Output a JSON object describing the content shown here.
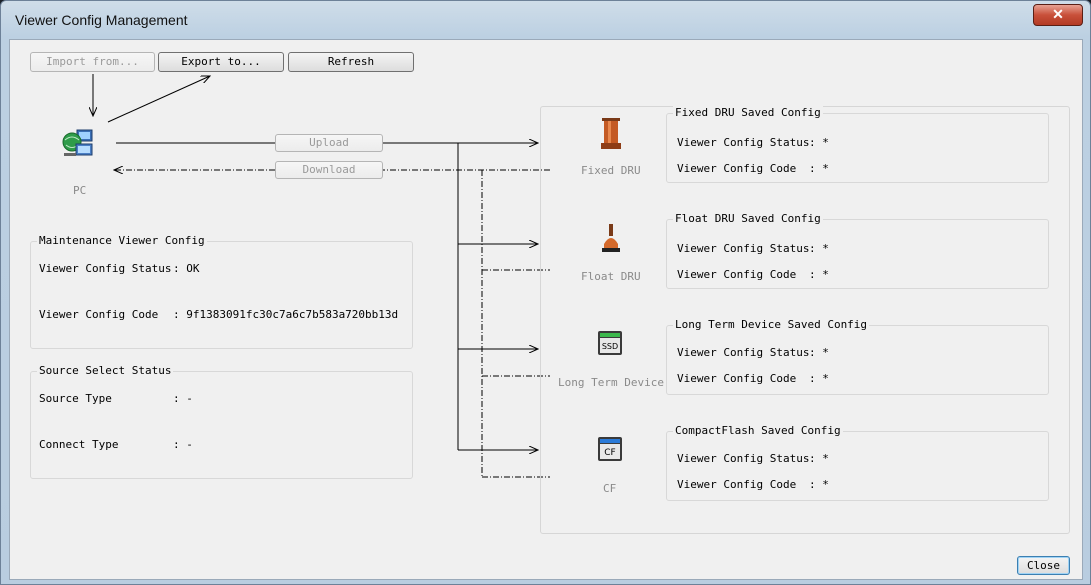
{
  "window": {
    "title": "Viewer Config Management",
    "close_glyph": "✕"
  },
  "toolbar": {
    "import_label": "Import from...",
    "export_label": "Export to...",
    "refresh_label": "Refresh"
  },
  "pc": {
    "label": "PC",
    "icon": "pc-network-icon"
  },
  "transfer": {
    "upload_label": "Upload",
    "download_label": "Download"
  },
  "maintenance": {
    "title": "Maintenance Viewer Config",
    "status_label": "Viewer Config Status",
    "status_value": ": OK",
    "code_label": "Viewer Config Code",
    "code_value": ": 9f1383091fc30c7a6c7b583a720bb13d"
  },
  "source": {
    "title": "Source Select Status",
    "type_label": "Source Type",
    "type_value": ": -",
    "connect_label": "Connect Type",
    "connect_value": ": -"
  },
  "devices": [
    {
      "label": "Fixed DRU",
      "icon": "fixed-dru-icon",
      "config_title": "Fixed DRU Saved Config",
      "status_label": "Viewer Config Status",
      "status_value": ": *",
      "code_label": "Viewer Config Code",
      "code_value": ": *"
    },
    {
      "label": "Float DRU",
      "icon": "float-dru-icon",
      "config_title": "Float DRU Saved Config",
      "status_label": "Viewer Config Status",
      "status_value": ": *",
      "code_label": "Viewer Config Code",
      "code_value": ": *"
    },
    {
      "label": "Long Term Device",
      "icon": "ssd-icon",
      "icon_text": "SSD",
      "config_title": "Long Term Device Saved Config",
      "status_label": "Viewer Config Status",
      "status_value": ": *",
      "code_label": "Viewer Config Code",
      "code_value": ": *"
    },
    {
      "label": "CF",
      "icon": "compactflash-icon",
      "icon_text": "CF",
      "config_title": "CompactFlash Saved Config",
      "status_label": "Viewer Config Status",
      "status_value": ": *",
      "code_label": "Viewer Config Code",
      "code_value": ": *"
    }
  ],
  "footer": {
    "close_label": "Close"
  },
  "colors": {
    "title_close": "#c8503a",
    "panel": "#f0f0f0",
    "frame": "#bcd0e2"
  }
}
